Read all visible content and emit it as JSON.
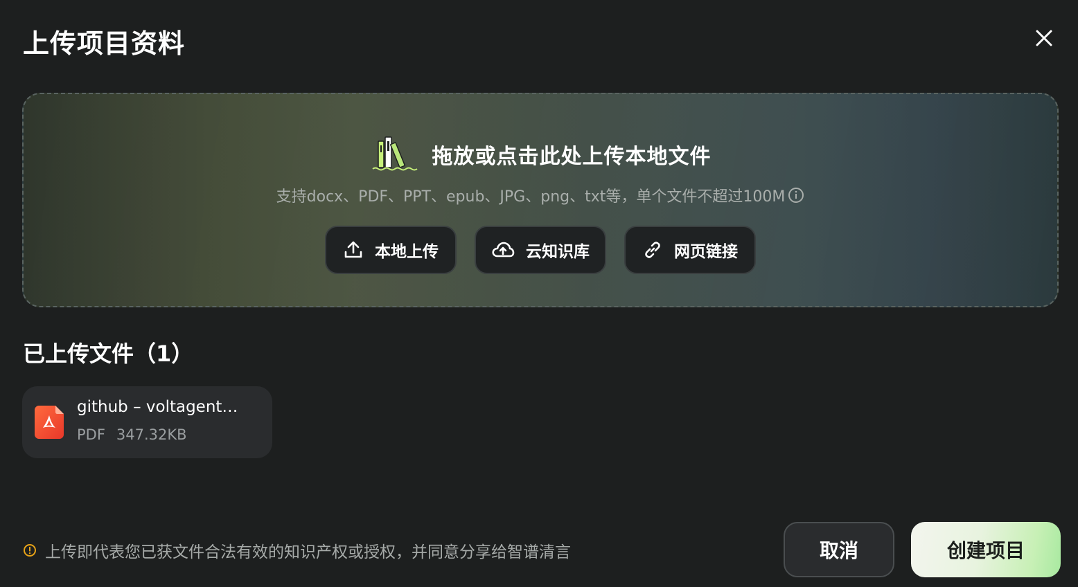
{
  "dialog": {
    "title": "上传项目资料"
  },
  "dropzone": {
    "headline": "拖放或点击此处上传本地文件",
    "subtitle": "支持docx、PDF、PPT、epub、JPG、png、txt等，单个文件不超过100M",
    "buttons": [
      {
        "label": "本地上传",
        "icon": "upload-icon"
      },
      {
        "label": "云知识库",
        "icon": "cloud-upload-icon"
      },
      {
        "label": "网页链接",
        "icon": "link-icon"
      }
    ]
  },
  "uploaded": {
    "title": "已上传文件（1）",
    "files": [
      {
        "name": "github – voltagent…",
        "type": "PDF",
        "size": "347.32KB",
        "icon": "pdf-icon"
      }
    ]
  },
  "footer": {
    "notice": "上传即代表您已获文件合法有效的知识产权或授权，并同意分享给智谱清言",
    "cancel_label": "取消",
    "create_label": "创建项目"
  },
  "colors": {
    "background": "#1d1f1f",
    "notice_icon": "#e8a317",
    "pdf_red": "#ef4a2a",
    "create_button": "#c8f0b6"
  }
}
